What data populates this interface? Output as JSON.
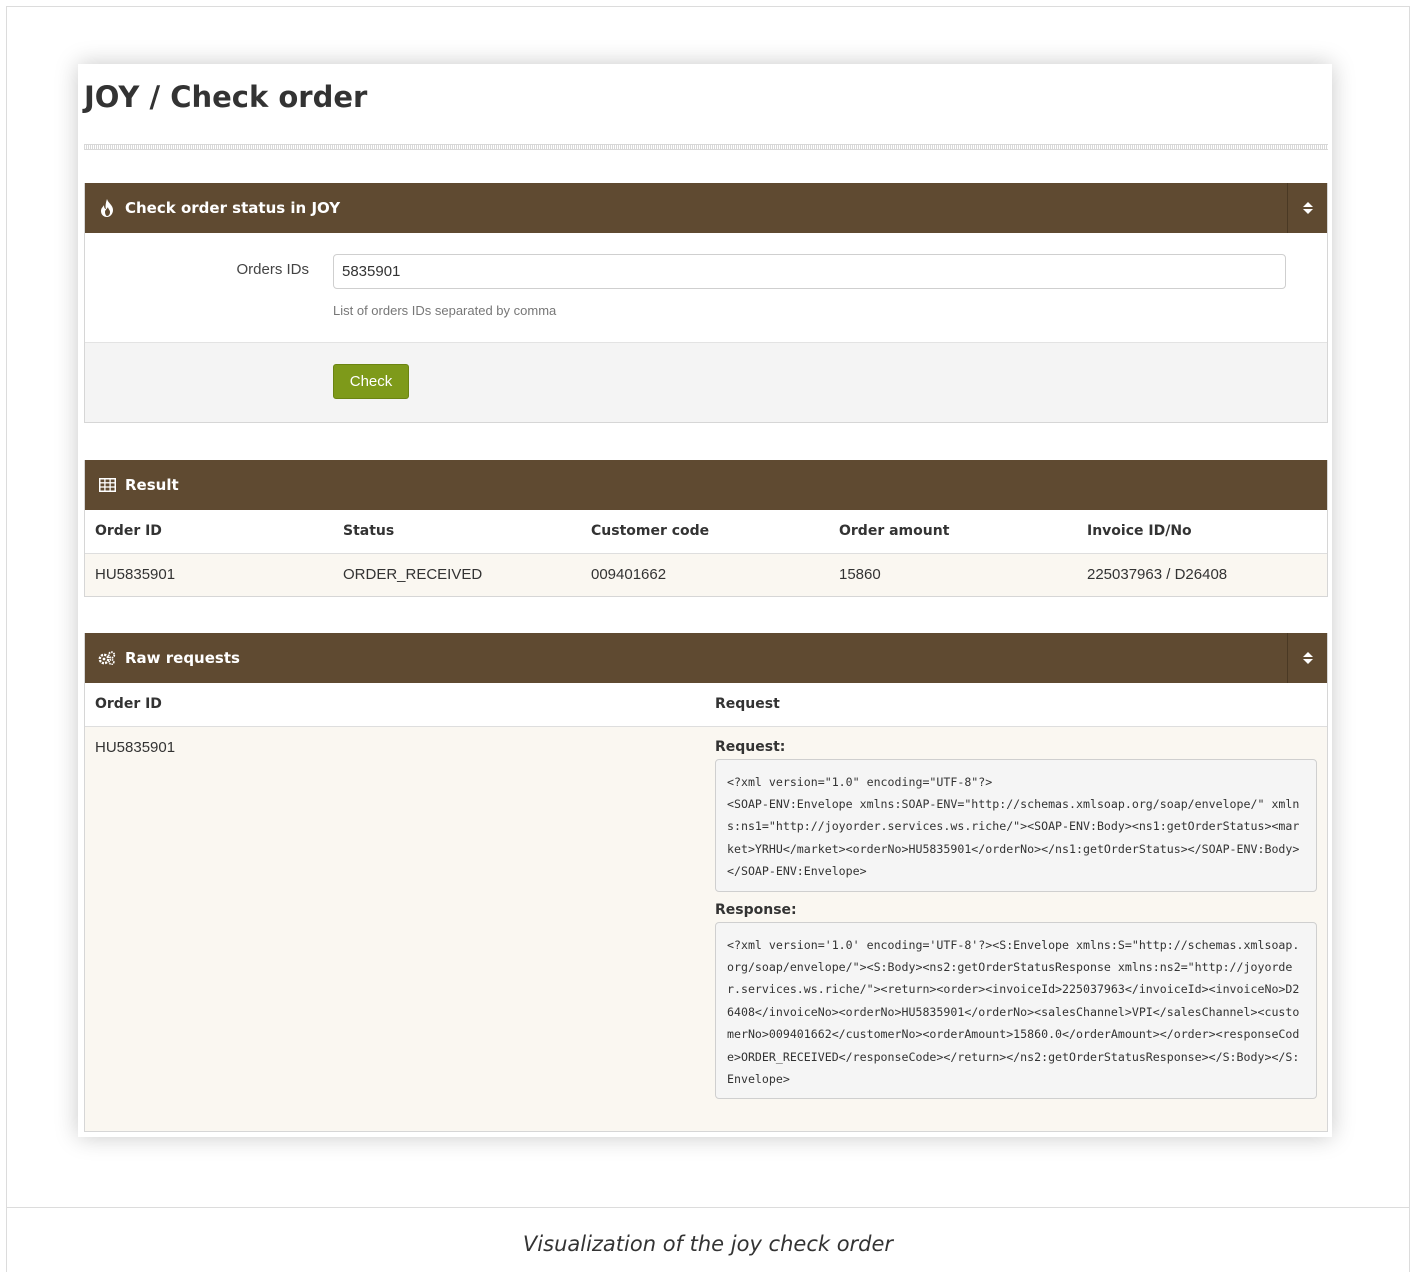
{
  "page": {
    "title": "JOY / Check order",
    "caption": "Visualization of the joy check order"
  },
  "check_panel": {
    "title": "Check order status in JOY",
    "icon": "fire-icon",
    "orders_label": "Orders IDs",
    "orders_value": "5835901",
    "orders_help": "List of orders IDs separated by comma",
    "check_button": "Check"
  },
  "result_panel": {
    "title": "Result",
    "icon": "table-icon",
    "columns": [
      "Order ID",
      "Status",
      "Customer code",
      "Order amount",
      "Invoice ID/No"
    ],
    "rows": [
      [
        "HU5835901",
        "ORDER_RECEIVED",
        "009401662",
        "15860",
        "225037963 / D26408"
      ]
    ]
  },
  "raw_panel": {
    "title": "Raw requests",
    "icon": "cogs-icon",
    "columns": [
      "Order ID",
      "Request"
    ],
    "order_id": "HU5835901",
    "request_label": "Request:",
    "request_xml": "<?xml version=\"1.0\" encoding=\"UTF-8\"?>\n<SOAP-ENV:Envelope xmlns:SOAP-ENV=\"http://schemas.xmlsoap.org/soap/envelope/\" xmlns:ns1=\"http://joyorder.services.ws.riche/\"><SOAP-ENV:Body><ns1:getOrderStatus><market>YRHU</market><orderNo>HU5835901</orderNo></ns1:getOrderStatus></SOAP-ENV:Body></SOAP-ENV:Envelope>",
    "response_label": "Response:",
    "response_xml": "<?xml version='1.0' encoding='UTF-8'?><S:Envelope xmlns:S=\"http://schemas.xmlsoap.org/soap/envelope/\"><S:Body><ns2:getOrderStatusResponse xmlns:ns2=\"http://joyorder.services.ws.riche/\"><return><order><invoiceId>225037963</invoiceId><invoiceNo>D26408</invoiceNo><orderNo>HU5835901</orderNo><salesChannel>VPI</salesChannel><customerNo>009401662</customerNo><orderAmount>15860.0</orderAmount></order><responseCode>ORDER_RECEIVED</responseCode></return></ns2:getOrderStatusResponse></S:Body></S:Envelope>"
  }
}
